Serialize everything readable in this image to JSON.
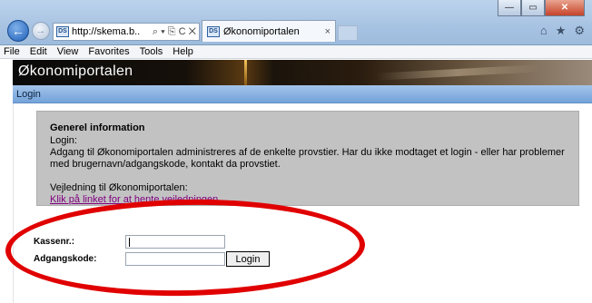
{
  "browser": {
    "address_text": "http://skema.b..",
    "address_tools": "⌕ ▾ ⎘ C ✕",
    "site_icon_text": "DS",
    "tab_title": "Økonomiportalen",
    "tab_close": "×",
    "window_buttons": {
      "minimize": "—",
      "maximize": "▭",
      "close": "✕"
    },
    "right_icons": [
      "⌂",
      "★",
      "⚙"
    ],
    "back_icon": "←",
    "forward_icon": "→"
  },
  "menu": [
    "File",
    "Edit",
    "View",
    "Favorites",
    "Tools",
    "Help"
  ],
  "page": {
    "banner_title": "Økonomiportalen",
    "nav_item": "Login",
    "info": {
      "heading": "Generel information",
      "login_label": "Login:",
      "text": "Adgang til Økonomiportalen administreres af de enkelte provstier. Har du ikke modtaget et login - eller har problemer med brugernavn/adgangskode, kontakt da provstiet.",
      "guide_label": "Vejledning til Økonomiportalen:",
      "guide_link": "Klik på linket for at hente vejledningen"
    },
    "form": {
      "kassenr_label": "Kassenr.:",
      "kassenr_value": "",
      "password_label": "Adgangskode:",
      "password_value": "",
      "login_button": "Login"
    }
  },
  "colors": {
    "annotation": "#e00000",
    "link": "#800080",
    "info_bg": "#c2c2c2",
    "nav_bar": "#8fb6e3"
  }
}
